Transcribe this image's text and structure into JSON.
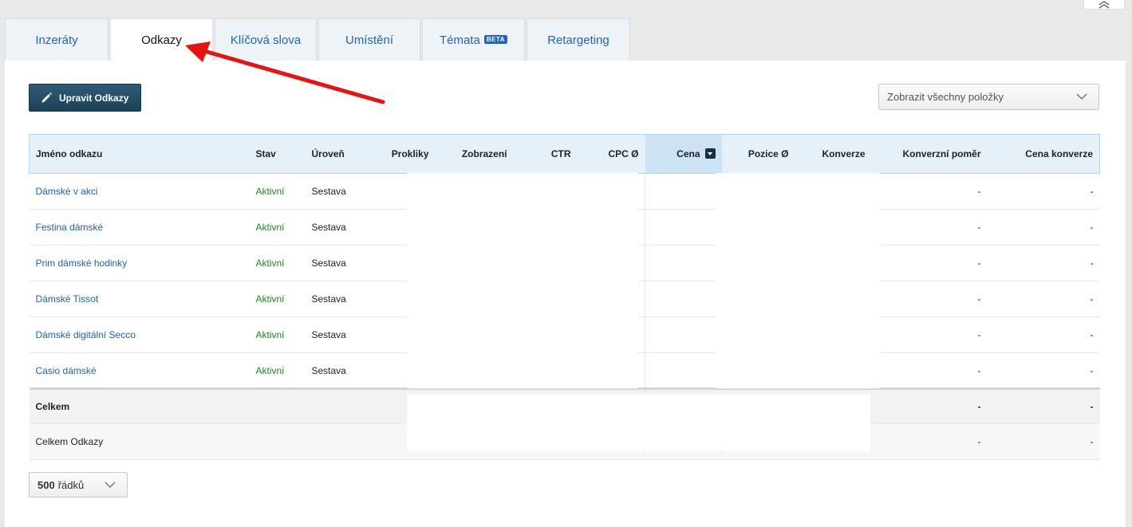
{
  "tabs": [
    {
      "label": "Inzeráty",
      "active": false
    },
    {
      "label": "Odkazy",
      "active": true
    },
    {
      "label": "Klíčová slova",
      "active": false
    },
    {
      "label": "Umístění",
      "active": false
    },
    {
      "label": "Témata",
      "badge": "BETA",
      "active": false
    },
    {
      "label": "Retargeting",
      "active": false
    }
  ],
  "toolbar": {
    "edit_label": "Upravit Odkazy",
    "filter_value": "Zobrazit všechny položky"
  },
  "table": {
    "columns": [
      "Jméno odkazu",
      "Stav",
      "Úroveň",
      "Prokliky",
      "Zobrazení",
      "CTR",
      "CPC Ø",
      "Cena",
      "Pozice Ø",
      "Konverze",
      "Konverzní poměr",
      "Cena konverze"
    ],
    "sorted_column": "Cena",
    "rows": [
      {
        "name": "Dámské v akci",
        "status": "Aktivní",
        "level": "Sestava",
        "conv_rate": "-",
        "conv_cost": "-"
      },
      {
        "name": "Festina dámské",
        "status": "Aktivní",
        "level": "Sestava",
        "conv_rate": "-",
        "conv_cost": "-"
      },
      {
        "name": "Prim dámské hodinky",
        "status": "Aktivní",
        "level": "Sestava",
        "conv_rate": "-",
        "conv_cost": "-"
      },
      {
        "name": "Dámské Tissot",
        "status": "Aktivní",
        "level": "Sestava",
        "conv_rate": "-",
        "conv_cost": "-"
      },
      {
        "name": "Dámské digitální Secco",
        "status": "Aktivní",
        "level": "Sestava",
        "conv_rate": "-",
        "conv_cost": "-"
      },
      {
        "name": "Casio dámské",
        "status": "Aktivní",
        "level": "Sestava",
        "conv_rate": "-",
        "conv_cost": "-"
      }
    ],
    "total": {
      "label": "Celkem",
      "conv_rate": "-",
      "conv_cost": "-"
    },
    "subtotal": {
      "label": "Celkem Odkazy",
      "conv_rate": "-",
      "conv_cost": "-"
    }
  },
  "pagination": {
    "rows_count": "500",
    "rows_label": "řádků"
  },
  "colors": {
    "link": "#1f5fbf",
    "status_active": "#1b8a1b",
    "header_bg": "#e6f0f8",
    "button_bg": "#254d66",
    "annotation_arrow": "#e8130f"
  }
}
